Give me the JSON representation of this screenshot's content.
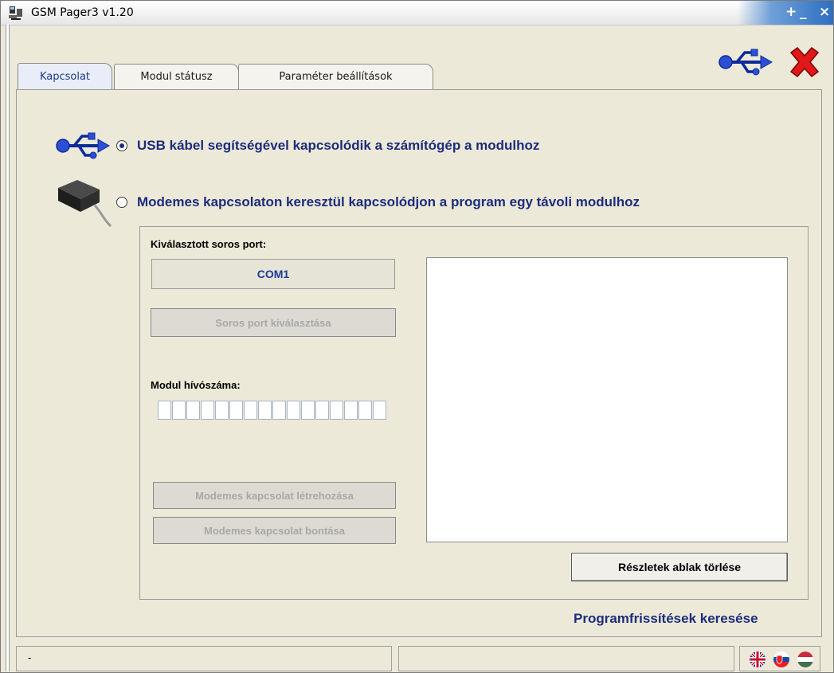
{
  "window": {
    "title": "GSM Pager3  v1.20",
    "controls": [
      "+",
      "_",
      "×"
    ]
  },
  "tabs": [
    {
      "label": "Kapcsolat",
      "active": true
    },
    {
      "label": "Modul státusz",
      "active": false
    },
    {
      "label": "Paraméter beállítások",
      "active": false
    }
  ],
  "header_icons": {
    "usb": "usb-icon",
    "close": "red-x-icon"
  },
  "connection": {
    "usb_option": "USB kábel segítségével kapcsolódik a számítógép a modulhoz",
    "usb_selected": true,
    "modem_option": "Modemes kapcsolaton keresztül kapcsolódjon a program egy távoli modulhoz",
    "modem_selected": false
  },
  "serial": {
    "label": "Kiválasztott soros port:",
    "value": "COM1",
    "select_button": "Soros port kiválasztása"
  },
  "modem": {
    "number_label": "Modul hívószáma:",
    "number_value": "",
    "connect_button": "Modemes kapcsolat létrehozása",
    "disconnect_button": "Modemes kapcsolat bontása"
  },
  "details": {
    "clear_button": "Részletek ablak törlése"
  },
  "update_link": "Programfrissítések keresése",
  "statusbar": {
    "text": "-",
    "flags": [
      "flag-uk-icon",
      "flag-sk-icon",
      "flag-hu-icon"
    ]
  },
  "colors": {
    "accent_text": "#1c2c7c",
    "com_text": "#1a3a9a"
  }
}
